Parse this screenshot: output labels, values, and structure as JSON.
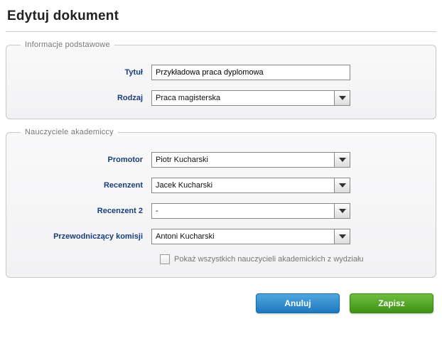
{
  "page_title": "Edytuj dokument",
  "basic_info": {
    "legend": "Informacje podstawowe",
    "title_label": "Tytuł",
    "title_value": "Przykładowa praca dyplomowa",
    "type_label": "Rodzaj",
    "type_value": "Praca magisterska"
  },
  "teachers": {
    "legend": "Nauczyciele akademiccy",
    "promoter_label": "Promotor",
    "promoter_value": "Piotr Kucharski",
    "reviewer_label": "Recenzent",
    "reviewer_value": "Jacek Kucharski",
    "reviewer2_label": "Recenzent 2",
    "reviewer2_value": "-",
    "chairman_label": "Przewodniczący komisji",
    "chairman_value": "Antoni Kucharski",
    "show_all_label": "Pokaż wszystkich nauczycieli akademickich z wydziału",
    "show_all_checked": false
  },
  "actions": {
    "cancel": "Anuluj",
    "save": "Zapisz"
  }
}
